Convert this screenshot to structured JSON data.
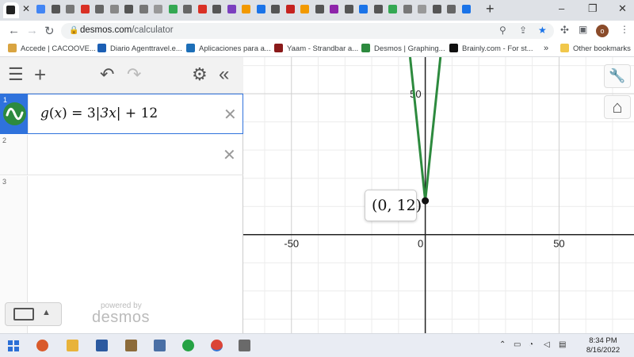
{
  "browser": {
    "url_host": "desmos.com",
    "url_path": "/calculator",
    "profile_initial": "o",
    "bookmarks": [
      {
        "label": "Accede | CACOOVE...",
        "color": "#d9a441"
      },
      {
        "label": "Diario Agenttravel.e...",
        "color": "#1c5fb4"
      },
      {
        "label": "Aplicaciones para a...",
        "color": "#1d6fb8"
      },
      {
        "label": "Yaam - Strandbar a...",
        "color": "#8a1a1a"
      },
      {
        "label": "Desmos | Graphing...",
        "color": "#2d8a3e"
      },
      {
        "label": "Brainly.com - For st...",
        "color": "#111111"
      }
    ],
    "bookmarks_overflow": "»",
    "other_bookmarks": "Other bookmarks",
    "new_tab": "+",
    "minimize": "–",
    "maximize": "❐",
    "close": "✕",
    "tab_close": "✕"
  },
  "toolbar": {
    "menu_icon": "☰",
    "add_icon": "+",
    "undo_icon": "↶",
    "redo_icon": "↷",
    "settings_icon": "⚙",
    "collapse_icon": "«"
  },
  "expressions": [
    {
      "num": "1",
      "func": "g",
      "var": "x",
      "text_before": "= 3",
      "abs_inner": "3x",
      "text_after": "+ 12",
      "color": "#2d8a3e",
      "delete": "✕"
    },
    {
      "num": "2",
      "delete": "✕"
    },
    {
      "num": "3"
    }
  ],
  "keypad": {
    "arrow": "▲"
  },
  "branding": {
    "powered": "powered by",
    "name": "desmos"
  },
  "graph": {
    "tick_labels": {
      "x_neg": "-50",
      "x_zero": "0",
      "x_pos": "50",
      "y_pos": "50"
    },
    "point_label": "(0, 12)",
    "point": {
      "x": 0,
      "y": 12
    },
    "line_color": "#2d8a3e",
    "wrench_icon": "🔧",
    "home_icon": "⌂"
  },
  "chart_data": {
    "type": "line",
    "title": "",
    "xlabel": "",
    "ylabel": "",
    "xlim": [
      -68,
      78
    ],
    "ylim": [
      -35,
      63
    ],
    "grid": true,
    "series": [
      {
        "values": [
          [
            -5.67,
            63
          ],
          [
            0,
            12
          ],
          [
            5.67,
            63
          ]
        ]
      }
    ],
    "points": [
      {
        "x": 0,
        "y": 12,
        "label": "(0, 12)"
      }
    ]
  },
  "taskbar": {
    "time": "8:34 PM",
    "date": "8/16/2022"
  }
}
